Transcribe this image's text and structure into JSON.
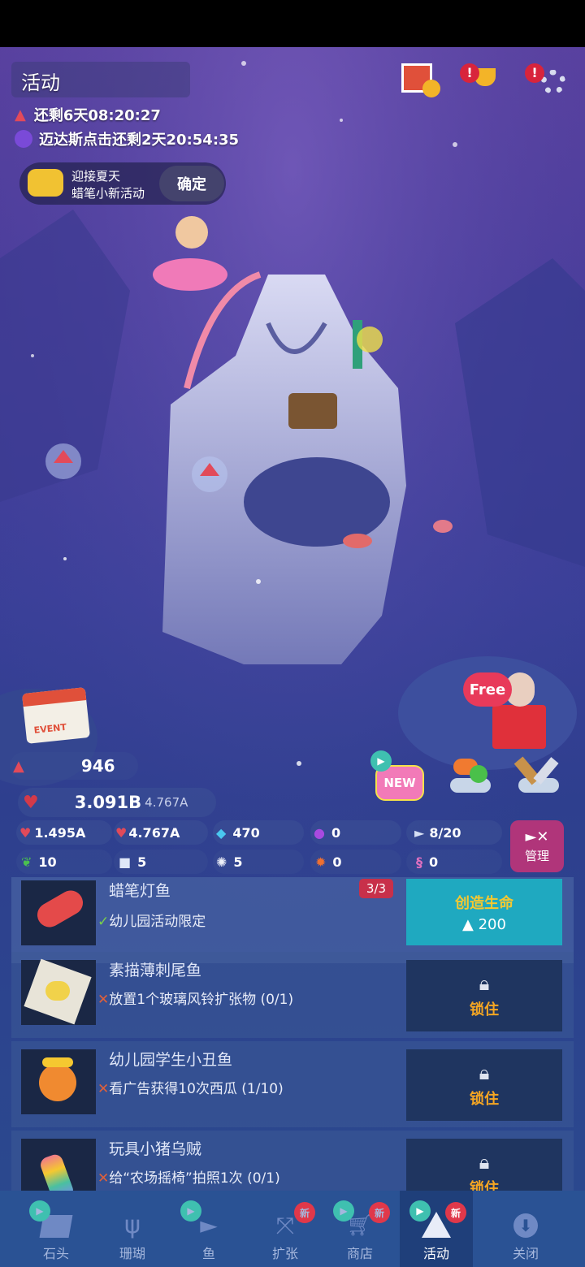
{
  "header": {
    "title": "活动",
    "timer1": "还剩6天08:20:27",
    "timer2": "迈达斯点击还剩2天20:54:35",
    "quest_line1": "迎接夏天",
    "quest_line2": "蜡笔小新活动",
    "confirm_label": "确定"
  },
  "scene": {
    "free_label": "Free",
    "event_label": "EVENT"
  },
  "currency": {
    "watermelon": "946",
    "vitality": "3.091B",
    "vitality_rate": "4.767A"
  },
  "stats": {
    "tap": "1.495A",
    "auto": "4.767A",
    "gems": "470",
    "pearls": "0",
    "fish": "8/20",
    "leaf": "10",
    "ice": "5",
    "urchin": "5",
    "crab": "0",
    "seahorse": "0",
    "manage_label": "管理"
  },
  "shortcuts": {
    "new_label": "NEW"
  },
  "fish_list": [
    {
      "name": "蜡笔灯鱼",
      "condition": "幼儿园活动限定",
      "count": "3/3",
      "action": "创造生命",
      "cost": "200"
    },
    {
      "name": "素描薄刺尾鱼",
      "condition": "放置1个玻璃风铃扩张物 (0/1)",
      "action": "锁住"
    },
    {
      "name": "幼儿园学生小丑鱼",
      "condition": "看广告获得10次西瓜 (1/10)",
      "action": "锁住"
    },
    {
      "name": "玩具小猪乌贼",
      "condition": "给“农场摇椅”拍照1次 (0/1)",
      "action": "锁住"
    }
  ],
  "tabs": [
    {
      "label": "石头",
      "new": ""
    },
    {
      "label": "珊瑚",
      "new": ""
    },
    {
      "label": "鱼",
      "new": ""
    },
    {
      "label": "扩张",
      "new": "新"
    },
    {
      "label": "商店",
      "new": "新"
    },
    {
      "label": "活动",
      "new": "新"
    },
    {
      "label": "关闭",
      "new": ""
    }
  ],
  "colors": {
    "accent_teal": "#1fa9c0",
    "lock_orange": "#f5a623",
    "badge_red": "#e0384a",
    "manage_pink": "#b0357a"
  }
}
